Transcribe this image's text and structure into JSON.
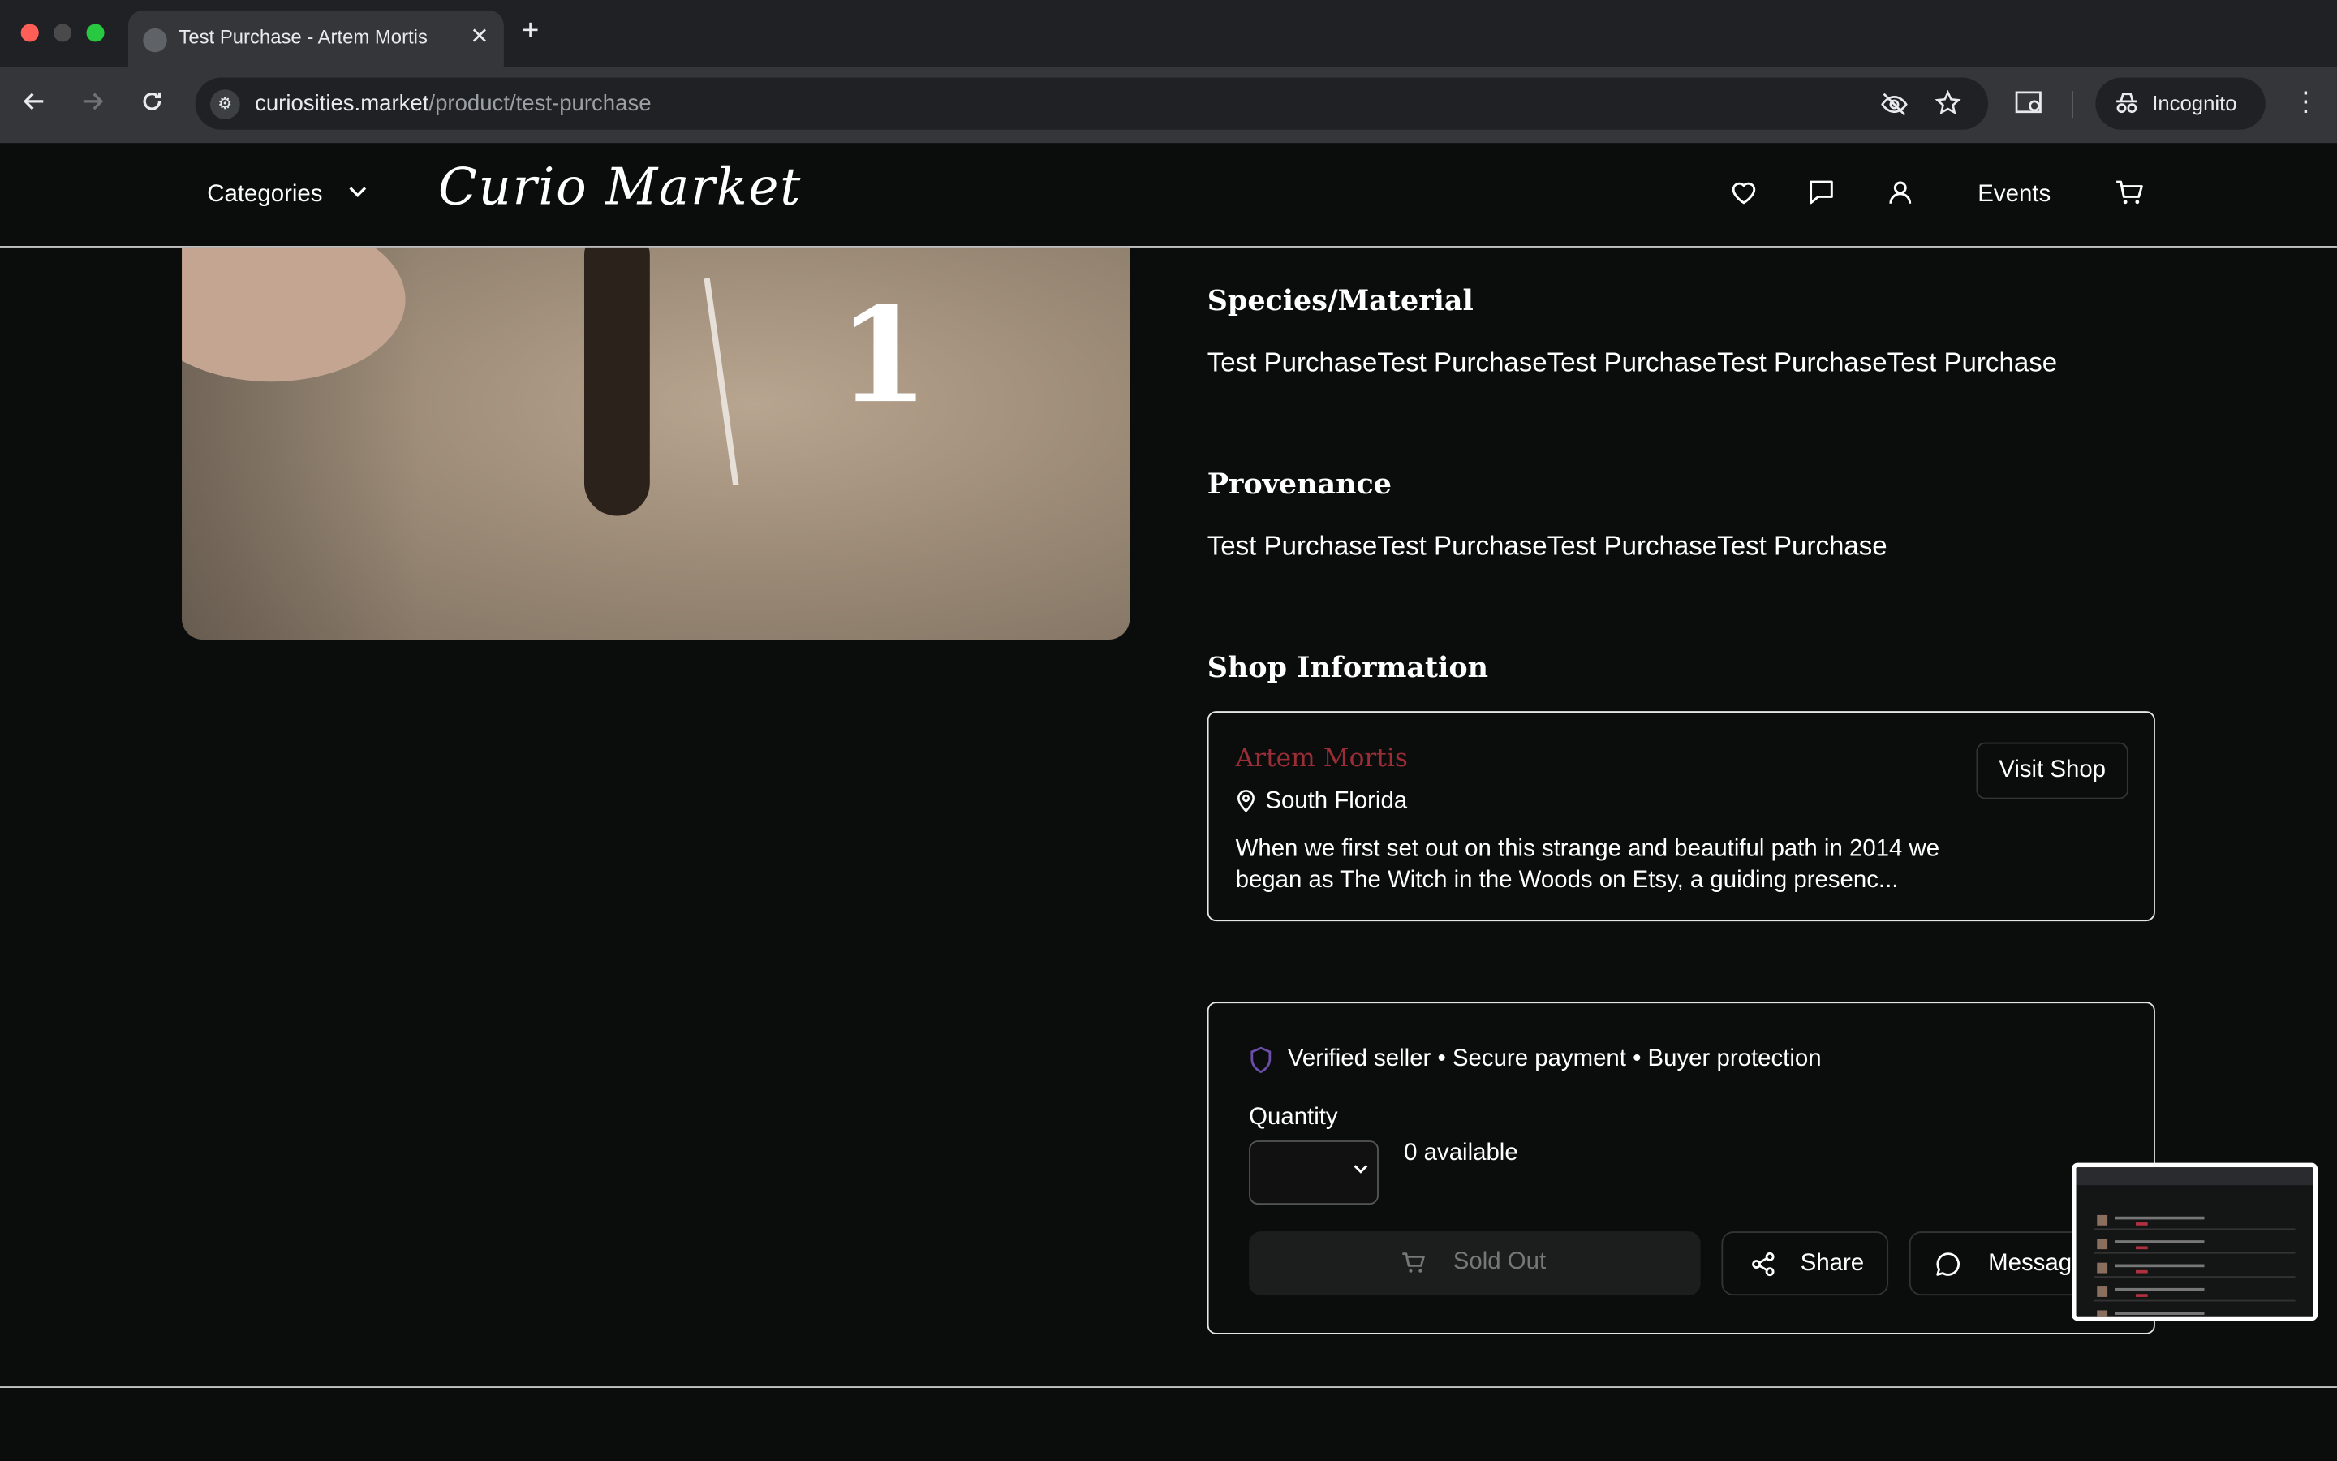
{
  "browser": {
    "tab_title": "Test Purchase - Artem Mortis",
    "tab_close": "✕",
    "new_tab": "+",
    "url_host": "curiosities.market",
    "url_path": "/product/test-purchase",
    "incognito_label": "Incognito"
  },
  "header": {
    "categories_label": "Categories",
    "logo_text": "Curio Market",
    "events_label": "Events"
  },
  "product": {
    "image_overlay_number": "1",
    "species_heading": "Species/Material",
    "species_text": "Test PurchaseTest PurchaseTest PurchaseTest PurchaseTest Purchase",
    "provenance_heading": "Provenance",
    "provenance_text": "Test PurchaseTest PurchaseTest PurchaseTest Purchase"
  },
  "shop": {
    "heading": "Shop Information",
    "name": "Artem Mortis",
    "location": "South Florida",
    "description": "When we first set out on this strange and beautiful path in 2014 we began as The Witch in the Woods on Etsy, a guiding presenc...",
    "visit_label": "Visit Shop",
    "name_color": "#9b2d36"
  },
  "purchase": {
    "trust_text": "Verified seller • Secure payment • Buyer protection",
    "quantity_label": "Quantity",
    "quantity_value": "",
    "available_text": "0 available",
    "sold_out_label": "Sold Out",
    "share_label": "Share",
    "message_label": "Message",
    "shield_color": "#6b4fa8"
  },
  "icons": {
    "header": [
      "heart-icon",
      "chat-icon",
      "user-icon",
      "cart-icon"
    ],
    "toolbar": [
      "back-icon",
      "forward-icon",
      "reload-icon",
      "site-settings-icon",
      "eye-off-icon",
      "star-icon",
      "tab-search-icon",
      "incognito-icon",
      "menu-icon"
    ]
  }
}
